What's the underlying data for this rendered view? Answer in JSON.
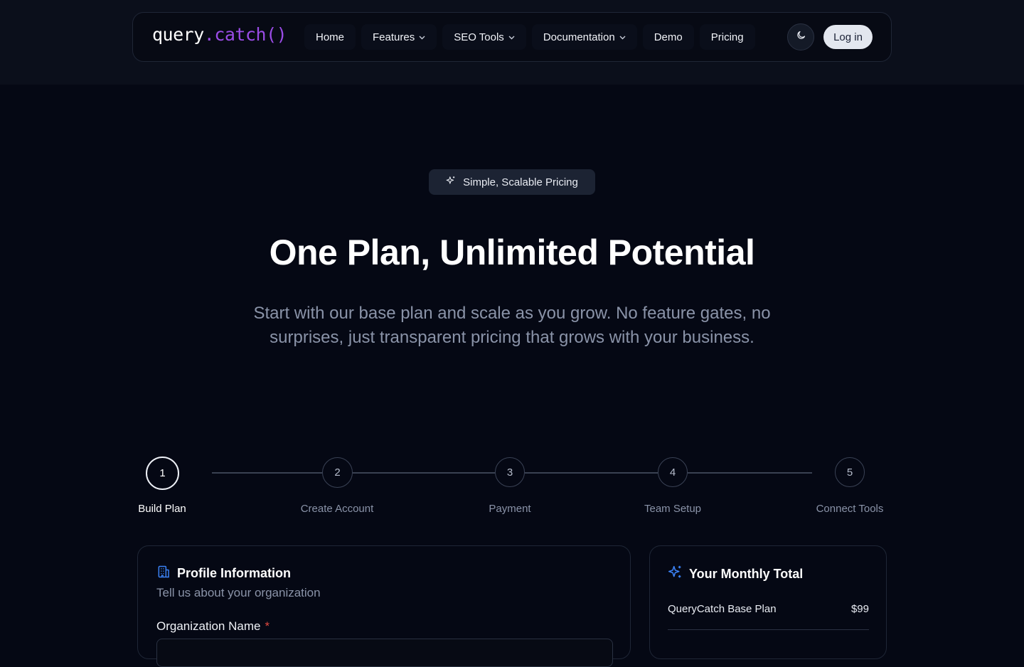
{
  "logo": {
    "part1": "query",
    "part2": ".catch",
    "part3": "()"
  },
  "nav": {
    "items": [
      {
        "label": "Home",
        "dropdown": false
      },
      {
        "label": "Features",
        "dropdown": true
      },
      {
        "label": "SEO Tools",
        "dropdown": true
      },
      {
        "label": "Documentation",
        "dropdown": true
      },
      {
        "label": "Demo",
        "dropdown": false
      },
      {
        "label": "Pricing",
        "dropdown": false
      }
    ],
    "theme_icon": "moon-icon",
    "login_label": "Log in"
  },
  "hero": {
    "badge": "Simple, Scalable Pricing",
    "badge_icon": "sparkles-icon",
    "title": "One Plan, Unlimited Potential",
    "subtitle": "Start with our base plan and scale as you grow. No feature gates, no surprises, just transparent pricing that grows with your business."
  },
  "stepper": {
    "steps": [
      {
        "number": "1",
        "label": "Build Plan",
        "active": true
      },
      {
        "number": "2",
        "label": "Create Account",
        "active": false
      },
      {
        "number": "3",
        "label": "Payment",
        "active": false
      },
      {
        "number": "4",
        "label": "Team Setup",
        "active": false
      },
      {
        "number": "5",
        "label": "Connect Tools",
        "active": false
      }
    ]
  },
  "profile": {
    "icon": "building-icon",
    "title": "Profile Information",
    "description": "Tell us about your organization",
    "org_label": "Organization Name",
    "required_mark": "*"
  },
  "total": {
    "icon": "sparkles-icon",
    "title": "Your Monthly Total",
    "line_items": [
      {
        "name": "QueryCatch Base Plan",
        "price": "$99"
      }
    ]
  },
  "colors": {
    "accent_purple": "#9a4ce6",
    "accent_blue": "#3b82f6",
    "required_red": "#e0483f",
    "background": "#050814"
  }
}
